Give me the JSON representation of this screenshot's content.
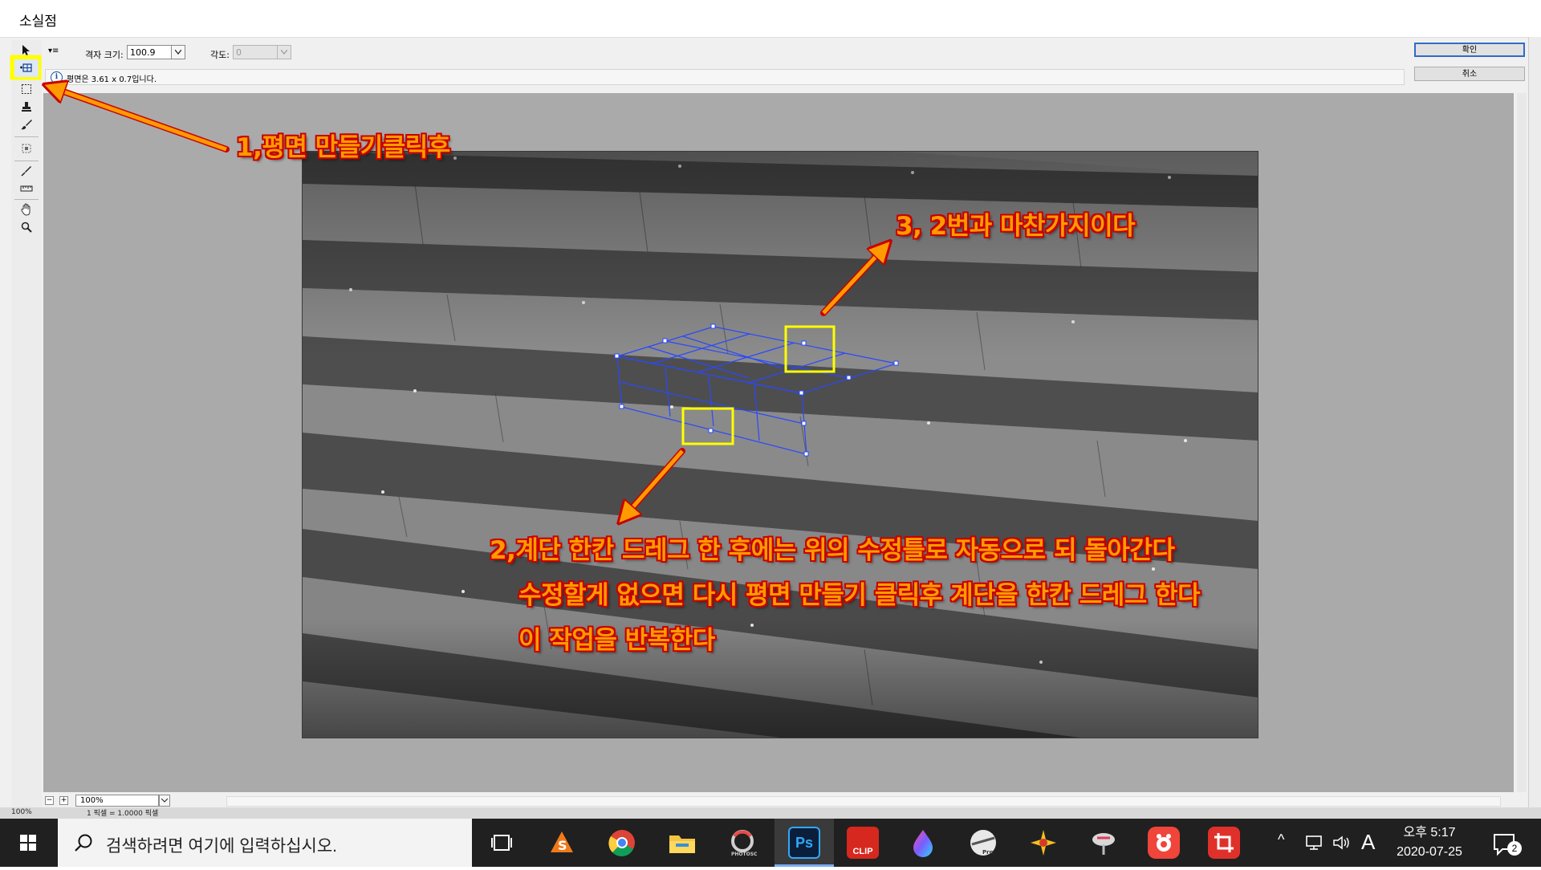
{
  "window": {
    "title": "소실점"
  },
  "options_bar": {
    "grid_size_label": "격자 크기:",
    "grid_size_value": "100.9",
    "angle_label": "각도:",
    "angle_value": "0"
  },
  "info_bar": {
    "message": "평면은 3.61 x 0.7입니다."
  },
  "buttons": {
    "ok": "확인",
    "cancel": "취소"
  },
  "bottom_bar": {
    "zoom": "100%",
    "ps_zoom": "100%",
    "ps_status": "1 픽셀 = 1.0000 픽셀"
  },
  "annotations": {
    "step1": "1,평면 만들기클릭후",
    "step3": "3, 2번과 마찬가지이다",
    "step2_line1": "2,계단 한칸 드레그 한 후에는 위의 수정틀로 자동으로 되 돌아간다",
    "step2_line2": "수정할게 없으면 다시 평면 만들기 클릭후 계단을 한칸 드레그 한다",
    "step2_line3": "이 작업을 반복한다",
    "text_color": "#ff9a00",
    "outline_color": "#c80000",
    "highlight_color": "#ffff00"
  },
  "taskbar": {
    "search_placeholder": "검색하려면 여기에 입력하십시오.",
    "apps": [
      "task-view",
      "sketchbook",
      "chrome",
      "file-explorer",
      "photoscape",
      "photoshop",
      "clip",
      "color-drop",
      "pro-app",
      "sparkle-app",
      "fan-app",
      "record-app",
      "crop-pro"
    ],
    "photoshop_label": "Ps",
    "clip_label": "CLIP",
    "ime_label": "A",
    "clock_time": "오후 5:17",
    "clock_date": "2020-07-25",
    "notification_count": "2"
  }
}
